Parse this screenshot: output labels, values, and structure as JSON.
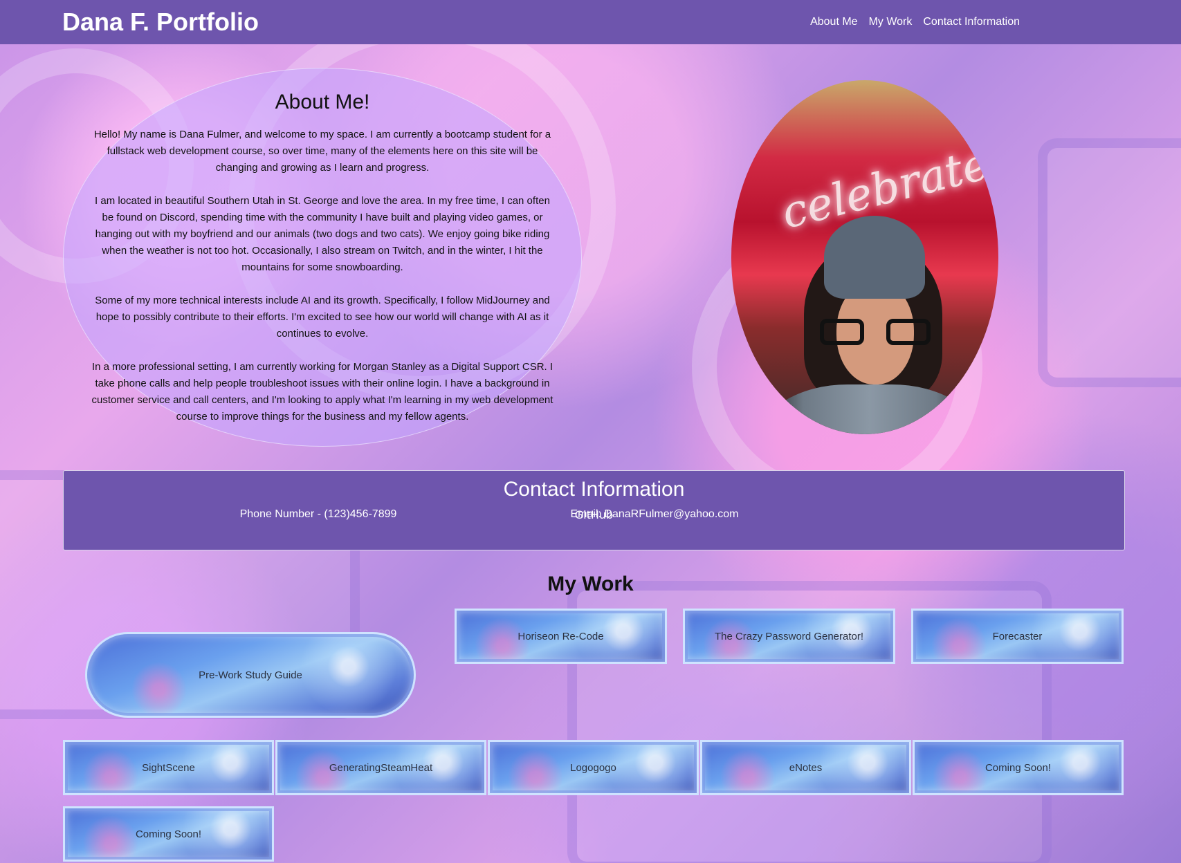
{
  "nav": {
    "brand": "Dana F. Portfolio",
    "links": [
      "About Me",
      "My Work",
      "Contact Information"
    ]
  },
  "about": {
    "title": "About Me!",
    "paragraphs": [
      "Hello! My name is Dana Fulmer, and welcome to my space. I am currently a bootcamp student for a fullstack web development course, so over time, many of the elements here on this site will be changing and growing as I learn and progress.",
      "I am located in beautiful Southern Utah in St. George and love the area. In my free time, I can often be found on Discord, spending time with the community I have built and playing video games, or hanging out with my boyfriend and our animals (two dogs and two cats). We enjoy going bike riding when the weather is not too hot. Occasionally, I also stream on Twitch, and in the winter, I hit the mountains for some snowboarding.",
      "Some of my more technical interests include AI and its growth. Specifically, I follow MidJourney and hope to possibly contribute to their efforts. I'm excited to see how our world will change with AI as it continues to evolve.",
      "In a more professional setting, I am currently working for Morgan Stanley as a Digital Support CSR. I take phone calls and help people troubleshoot issues with their online login. I have a background in customer service and call centers, and I'm looking to apply what I'm learning in my web development course to improve things for the business and my fellow agents."
    ]
  },
  "contact": {
    "title": "Contact Information",
    "phone": "Phone Number - (123)456-7899",
    "email": "Email: DanaRFulmer@yahoo.com",
    "github": "GitHub"
  },
  "work": {
    "title": "My Work",
    "projects": [
      "Horiseon Re-Code",
      "The Crazy Password Generator!",
      "Forecaster",
      "Pre-Work Study Guide",
      "SightScene",
      "GeneratingSteamHeat",
      "Logogogo",
      "eNotes",
      "Coming Soon!",
      "Coming Soon!"
    ]
  },
  "colors": {
    "nav_bg": "#6e55ad",
    "accent_text": "#ffffff"
  }
}
